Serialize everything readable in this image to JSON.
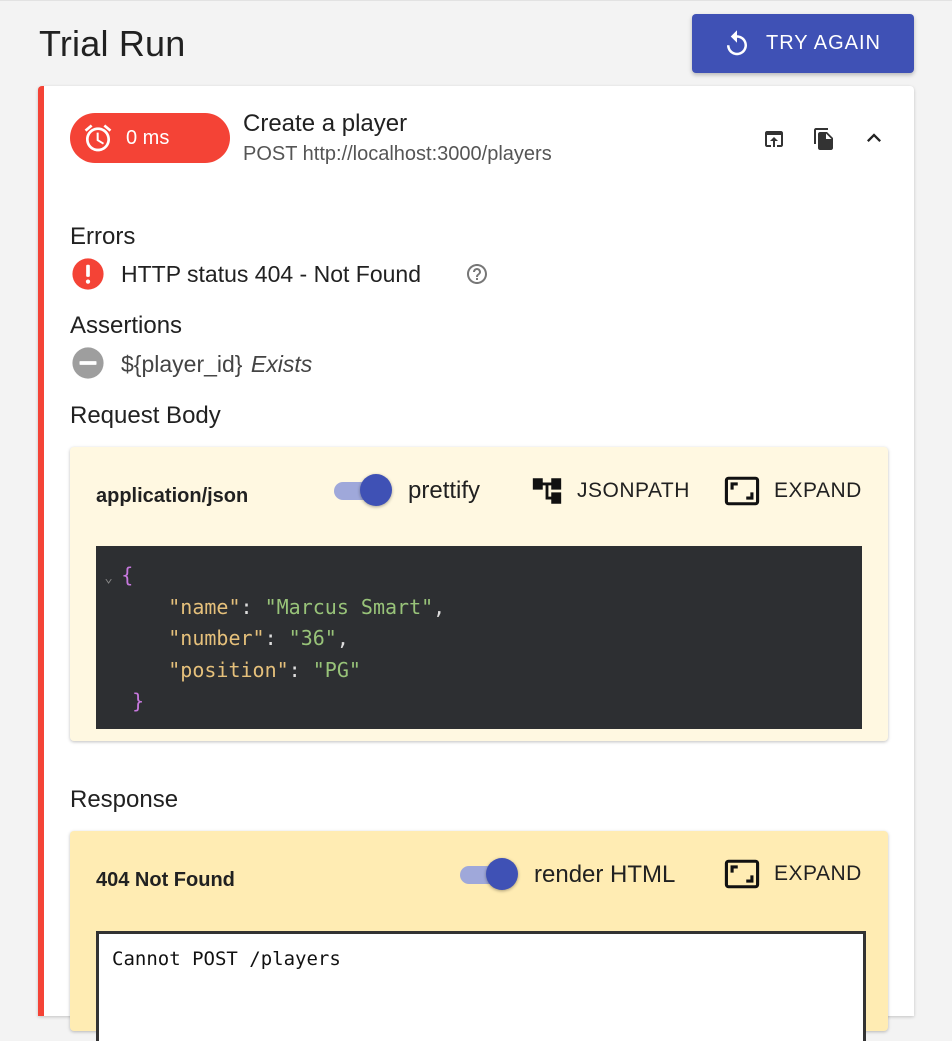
{
  "page": {
    "title": "Trial Run",
    "try_again_label": "TRY AGAIN"
  },
  "request": {
    "duration": "0 ms",
    "name": "Create a player",
    "method_url": "POST http://localhost:3000/players",
    "header_icons": [
      "open-in-new-icon",
      "copy-icon",
      "chevron-up-icon"
    ],
    "status_color": "#f44336"
  },
  "errors": {
    "heading": "Errors",
    "items": [
      {
        "icon": "error-icon",
        "text": "HTTP status 404 - Not Found",
        "help_icon": "help-icon"
      }
    ]
  },
  "assertions": {
    "heading": "Assertions",
    "items": [
      {
        "icon": "skipped-icon",
        "target": "${player_id}",
        "operator": "Exists"
      }
    ]
  },
  "request_body": {
    "heading": "Request Body",
    "content_type": "application/json",
    "toggle_label": "prettify",
    "toggle_on": true,
    "jsonpath_label": "JSONPATH",
    "expand_label": "EXPAND",
    "code": {
      "open": "{",
      "lines": [
        {
          "key": "\"name\"",
          "value": "\"Marcus Smart\"",
          "trail": ","
        },
        {
          "key": "\"number\"",
          "value": "\"36\"",
          "trail": ","
        },
        {
          "key": "\"position\"",
          "value": "\"PG\"",
          "trail": ""
        }
      ],
      "close": "}"
    }
  },
  "response": {
    "heading": "Response",
    "status_text": "404 Not Found",
    "toggle_label": "render HTML",
    "toggle_on": true,
    "expand_label": "EXPAND",
    "body_text": "Cannot POST /players"
  },
  "colors": {
    "primary": "#3f51b5",
    "error": "#f44336",
    "panel_light": "#fff8e1",
    "panel_warm": "#ffecb3",
    "code_bg": "#2d2f32"
  }
}
